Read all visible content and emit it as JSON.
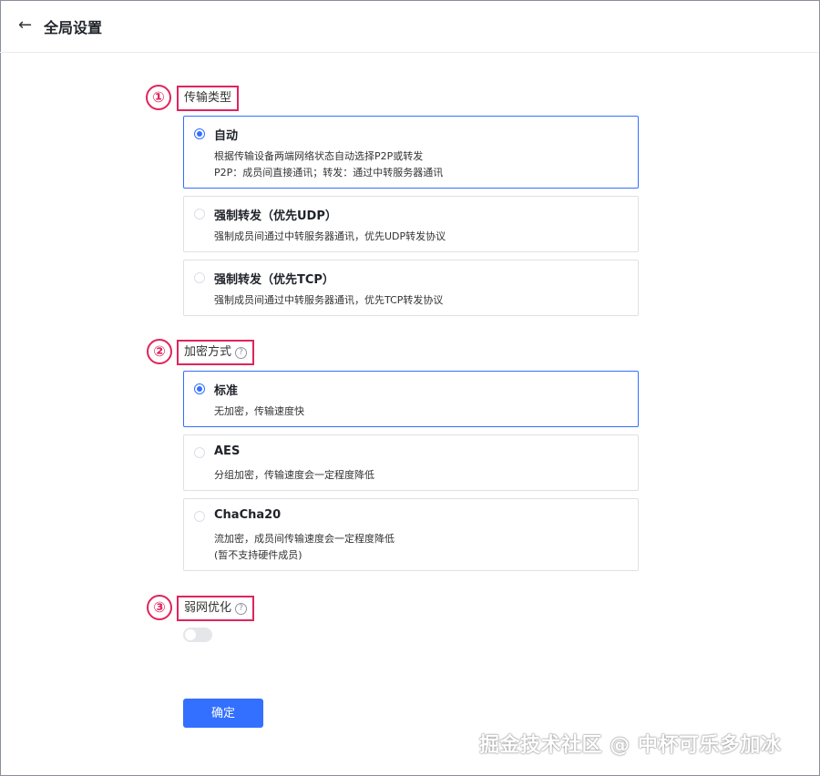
{
  "header": {
    "title": "全局设置"
  },
  "transport": {
    "number": "①",
    "label": "传输类型",
    "options": [
      {
        "title": "自动",
        "desc": [
          "根据传输设备两端网络状态自动选择P2P或转发",
          "P2P：成员间直接通讯；转发：通过中转服务器通讯"
        ],
        "selected": true
      },
      {
        "title": "强制转发（优先UDP）",
        "desc": [
          "强制成员间通过中转服务器通讯，优先UDP转发协议"
        ],
        "selected": false
      },
      {
        "title": "强制转发（优先TCP）",
        "desc": [
          "强制成员间通过中转服务器通讯，优先TCP转发协议"
        ],
        "selected": false
      }
    ]
  },
  "encryption": {
    "number": "②",
    "label": "加密方式",
    "options": [
      {
        "title": "标准",
        "desc": [
          "无加密，传输速度快"
        ],
        "selected": true
      },
      {
        "title": "AES",
        "desc": [
          "分组加密，传输速度会一定程度降低"
        ],
        "selected": false
      },
      {
        "title": "ChaCha20",
        "desc": [
          "流加密，成员间传输速度会一定程度降低",
          "(暂不支持硬件成员)"
        ],
        "selected": false
      }
    ]
  },
  "weak_network": {
    "number": "③",
    "label": "弱网优化",
    "enabled": false
  },
  "confirm_label": "确定",
  "watermark": "掘金技术社区 @ 中杯可乐多加冰",
  "colors": {
    "accent": "#3370ff",
    "annotation": "#e0245e"
  }
}
